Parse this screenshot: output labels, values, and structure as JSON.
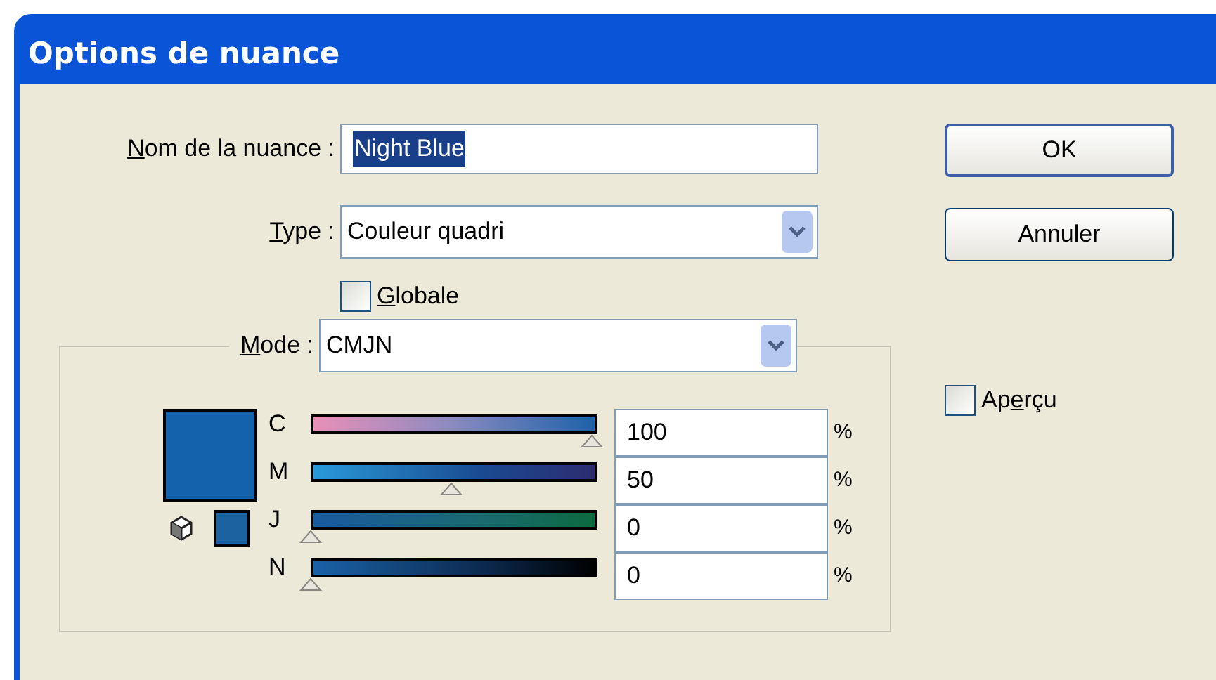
{
  "window": {
    "title": "Options de nuance"
  },
  "name_field": {
    "label": "Nom de la nuance :",
    "value": "Night Blue"
  },
  "type_field": {
    "label": "Type :",
    "value": "Couleur quadri"
  },
  "global_checkbox": {
    "label": "Globale",
    "checked": false
  },
  "mode_field": {
    "label": "Mode :",
    "value": "CMJN"
  },
  "preview_checkbox": {
    "label": "Aperçu",
    "checked": false
  },
  "buttons": [
    {
      "label": "OK",
      "default": true
    },
    {
      "label": "Annuler",
      "default": false
    }
  ],
  "channels": [
    {
      "letter": "C",
      "level": 1,
      "value": "100",
      "unit": "%"
    },
    {
      "letter": "M",
      "level": 0.5,
      "value": "50",
      "unit": "%"
    },
    {
      "letter": "J",
      "level": 0,
      "value": "0",
      "unit": "%"
    },
    {
      "letter": "N",
      "level": 0,
      "value": "0",
      "unit": "%"
    }
  ]
}
